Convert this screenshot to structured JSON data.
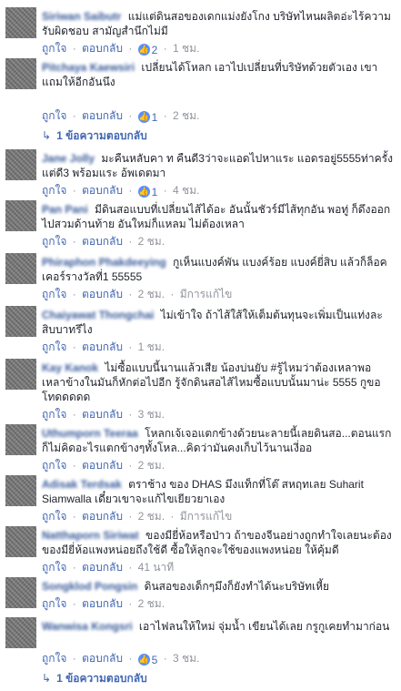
{
  "actions": {
    "like": "ถูกใจ",
    "reply": "ตอบกลับ",
    "edited": "มีการแก้ไข",
    "dot": "·"
  },
  "comments": [
    {
      "name": "Siriwan Saibutr",
      "text": "แม่แต่ดินสอของเดกแม่งยังโกง บริษัทไหนผลิตอ่ะไร้ความรับผิดชอบ สามัญสำนึกไม่มี",
      "reactions": "2",
      "time": "1 ชม."
    },
    {
      "name": "Pitchaya Kaewsiri",
      "text": "เปลี่ยนได้โหลก เอาไปเปลี่ยนที่บริษัทด้วยตัวเอง เขาแถมให้อีกอันนึง",
      "reactions": "1",
      "time": "2 ชม.",
      "replies": "1 ข้อความตอบกลับ"
    },
    {
      "name": "Jane Jolly",
      "text": "มะคืนหลับคา ท คืนดี3ว่าจะแอดไปหาแระ แอดรอยู่5555ท่าครั้งแต่ดี3 พร้อมแระ อ้พเดตมา",
      "reactions": "1",
      "time": "4 ชม."
    },
    {
      "name": "Pan Pani",
      "text": "มีดินสอแบบที่เปลี่ยนไส้ได้อะ อันนั้นชัวร์มีไส้ทุกอัน พอทู่ ก็ดึงออกไปสวมด้านท้าย อันใหม่ก็แหลม ไม่ต้องเหลา",
      "time": "2 ชม."
    },
    {
      "name": "Phiraphon Phakdeeying",
      "text": "กูเห็นแบงค์พัน แบงค์ร้อย แบงค์ยี่สิบ แล้วก็ล็อคเคอร์รางวัลที่1 55555",
      "time": "2 ชม.",
      "edited": true
    },
    {
      "name": "Chaiyawat Thongchai",
      "text": "ไม่เข้าใจ ถ้าไส้ใส้ให้เต็มต้นทุนจะเพิ่มเป็นแท่งละสิบบาทรึไง",
      "time": "1 ชม."
    },
    {
      "name": "Kay Kanok",
      "text": "ไม่ซื้อแบบนี้นานแล้วเสีย น้องบ่นยับ #รู้ไหมว่าต้องเหลาพอเหลาข้างในมันก็หักต่อไปอีก รู้จักดินสอไส้ไหมซื้อแบบนั้นมาน่ะ 5555 กูขอโทดดดดด",
      "time": "3 ชม."
    },
    {
      "name": "Uthumporn Teeraa",
      "text": "โหลกเจ้เจอแตกข้างด้วยนะลายนี้เลยดินสอ...ตอนแรกก็ไม่คิดอะไรแตกข้างๆทั้งโหล...คิดว่ามันคงเก็บไว้นานเงี่ออ",
      "time": "2 ชม."
    },
    {
      "name": "Adisak Terdsak",
      "text": "ตราช้าง ของ DHAS มึงแท็กที่โต๊ สหฤทเลย Suharit Siamwalla เดี๋ยวเขาจะแก้ไขเยียวยาเอง",
      "time": "2 ชม.",
      "edited": true
    },
    {
      "name": "Natthaporn Siriwat",
      "text": "ของมียี่ห้อหรือป่าว ถ้าของจีนอย่างถูกทำใจเลยนะต้องของมียี่ห้อแพงหน่อยถึงใช้ดี ซื้อให้ลูกจะใช้ของแพงหน่อย ให้คุ้มดี",
      "time": "41 นาที"
    },
    {
      "name": "Songklod Pongsin",
      "text": "ดินสอของเด็กๆมึงก็ยังทำได้นะบริษัทเหี้ย",
      "time": "2 ชม."
    },
    {
      "name": "Wanwisa Kongsri",
      "text": "เอาไฟลนให้ใหม่ จุ่มน้ำ เขียนได้เลย กรูกูเคยทำมาก่อน",
      "reactions": "5",
      "time": "3 ชม.",
      "replies": "1 ข้อความตอบกลับ"
    }
  ]
}
